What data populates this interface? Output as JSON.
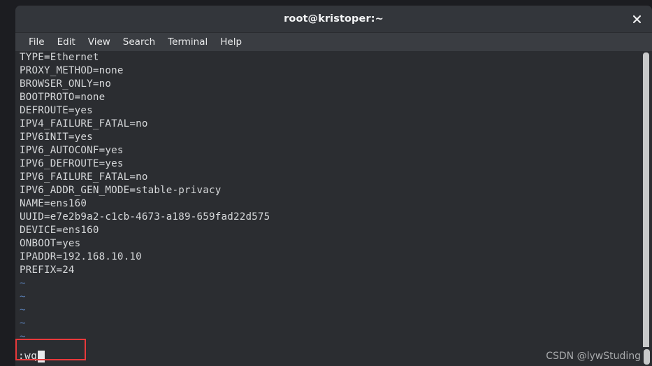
{
  "window": {
    "title": "root@kristoper:~",
    "close_icon": "close-icon"
  },
  "menubar": {
    "items": [
      {
        "label": "File"
      },
      {
        "label": "Edit"
      },
      {
        "label": "View"
      },
      {
        "label": "Search"
      },
      {
        "label": "Terminal"
      },
      {
        "label": "Help"
      }
    ]
  },
  "terminal": {
    "lines": [
      "TYPE=Ethernet",
      "PROXY_METHOD=none",
      "BROWSER_ONLY=no",
      "BOOTPROTO=none",
      "DEFROUTE=yes",
      "IPV4_FAILURE_FATAL=no",
      "IPV6INIT=yes",
      "IPV6_AUTOCONF=yes",
      "IPV6_DEFROUTE=yes",
      "IPV6_FAILURE_FATAL=no",
      "IPV6_ADDR_GEN_MODE=stable-privacy",
      "NAME=ens160",
      "UUID=e7e2b9a2-c1cb-4673-a189-659fad22d575",
      "DEVICE=ens160",
      "ONBOOT=yes",
      "IPADDR=192.168.10.10",
      "PREFIX=24"
    ],
    "empty_markers": [
      "~",
      "~",
      "~",
      "~",
      "~",
      "~"
    ]
  },
  "statusline": {
    "command": ":wq",
    "cursor": "block-cursor"
  },
  "watermark": {
    "text": "CSDN @lywStuding"
  },
  "colors": {
    "terminal_background": "#2b2d31",
    "titlebar_background": "#33363b",
    "menubar_background": "#3a3d42",
    "text": "#d6d8da",
    "tilde_blue": "#5a7fb5",
    "annotation_red": "#e8393b",
    "scrollbar": "#c8c9ca",
    "page_background": "#1c1d21"
  }
}
